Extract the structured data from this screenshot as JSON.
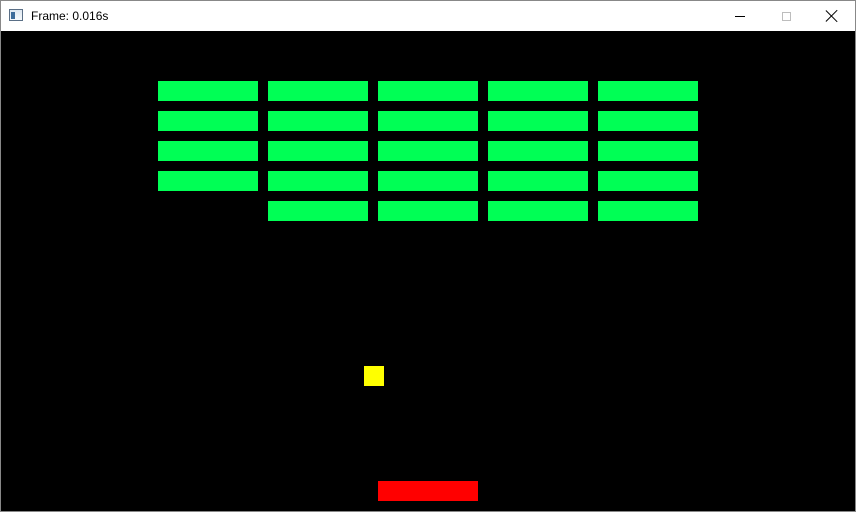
{
  "window": {
    "title": "Frame: 0.016s",
    "icons": {
      "app": "app-window-icon",
      "minimize": "minimize-icon",
      "maximize": "maximize-icon",
      "close": "close-icon"
    }
  },
  "game": {
    "colors": {
      "background": "#000000",
      "brick": "#00ff55",
      "ball": "#ffff00",
      "paddle": "#ff0000"
    },
    "bricks": [
      {
        "row": 0,
        "col": 0
      },
      {
        "row": 0,
        "col": 1
      },
      {
        "row": 0,
        "col": 2
      },
      {
        "row": 0,
        "col": 3
      },
      {
        "row": 0,
        "col": 4
      },
      {
        "row": 1,
        "col": 0
      },
      {
        "row": 1,
        "col": 1
      },
      {
        "row": 1,
        "col": 2
      },
      {
        "row": 1,
        "col": 3
      },
      {
        "row": 1,
        "col": 4
      },
      {
        "row": 2,
        "col": 0
      },
      {
        "row": 2,
        "col": 1
      },
      {
        "row": 2,
        "col": 2
      },
      {
        "row": 2,
        "col": 3
      },
      {
        "row": 2,
        "col": 4
      },
      {
        "row": 3,
        "col": 0
      },
      {
        "row": 3,
        "col": 1
      },
      {
        "row": 3,
        "col": 2
      },
      {
        "row": 3,
        "col": 3
      },
      {
        "row": 3,
        "col": 4
      },
      {
        "row": 4,
        "col": 1
      },
      {
        "row": 4,
        "col": 2
      },
      {
        "row": 4,
        "col": 3
      },
      {
        "row": 4,
        "col": 4
      }
    ]
  }
}
